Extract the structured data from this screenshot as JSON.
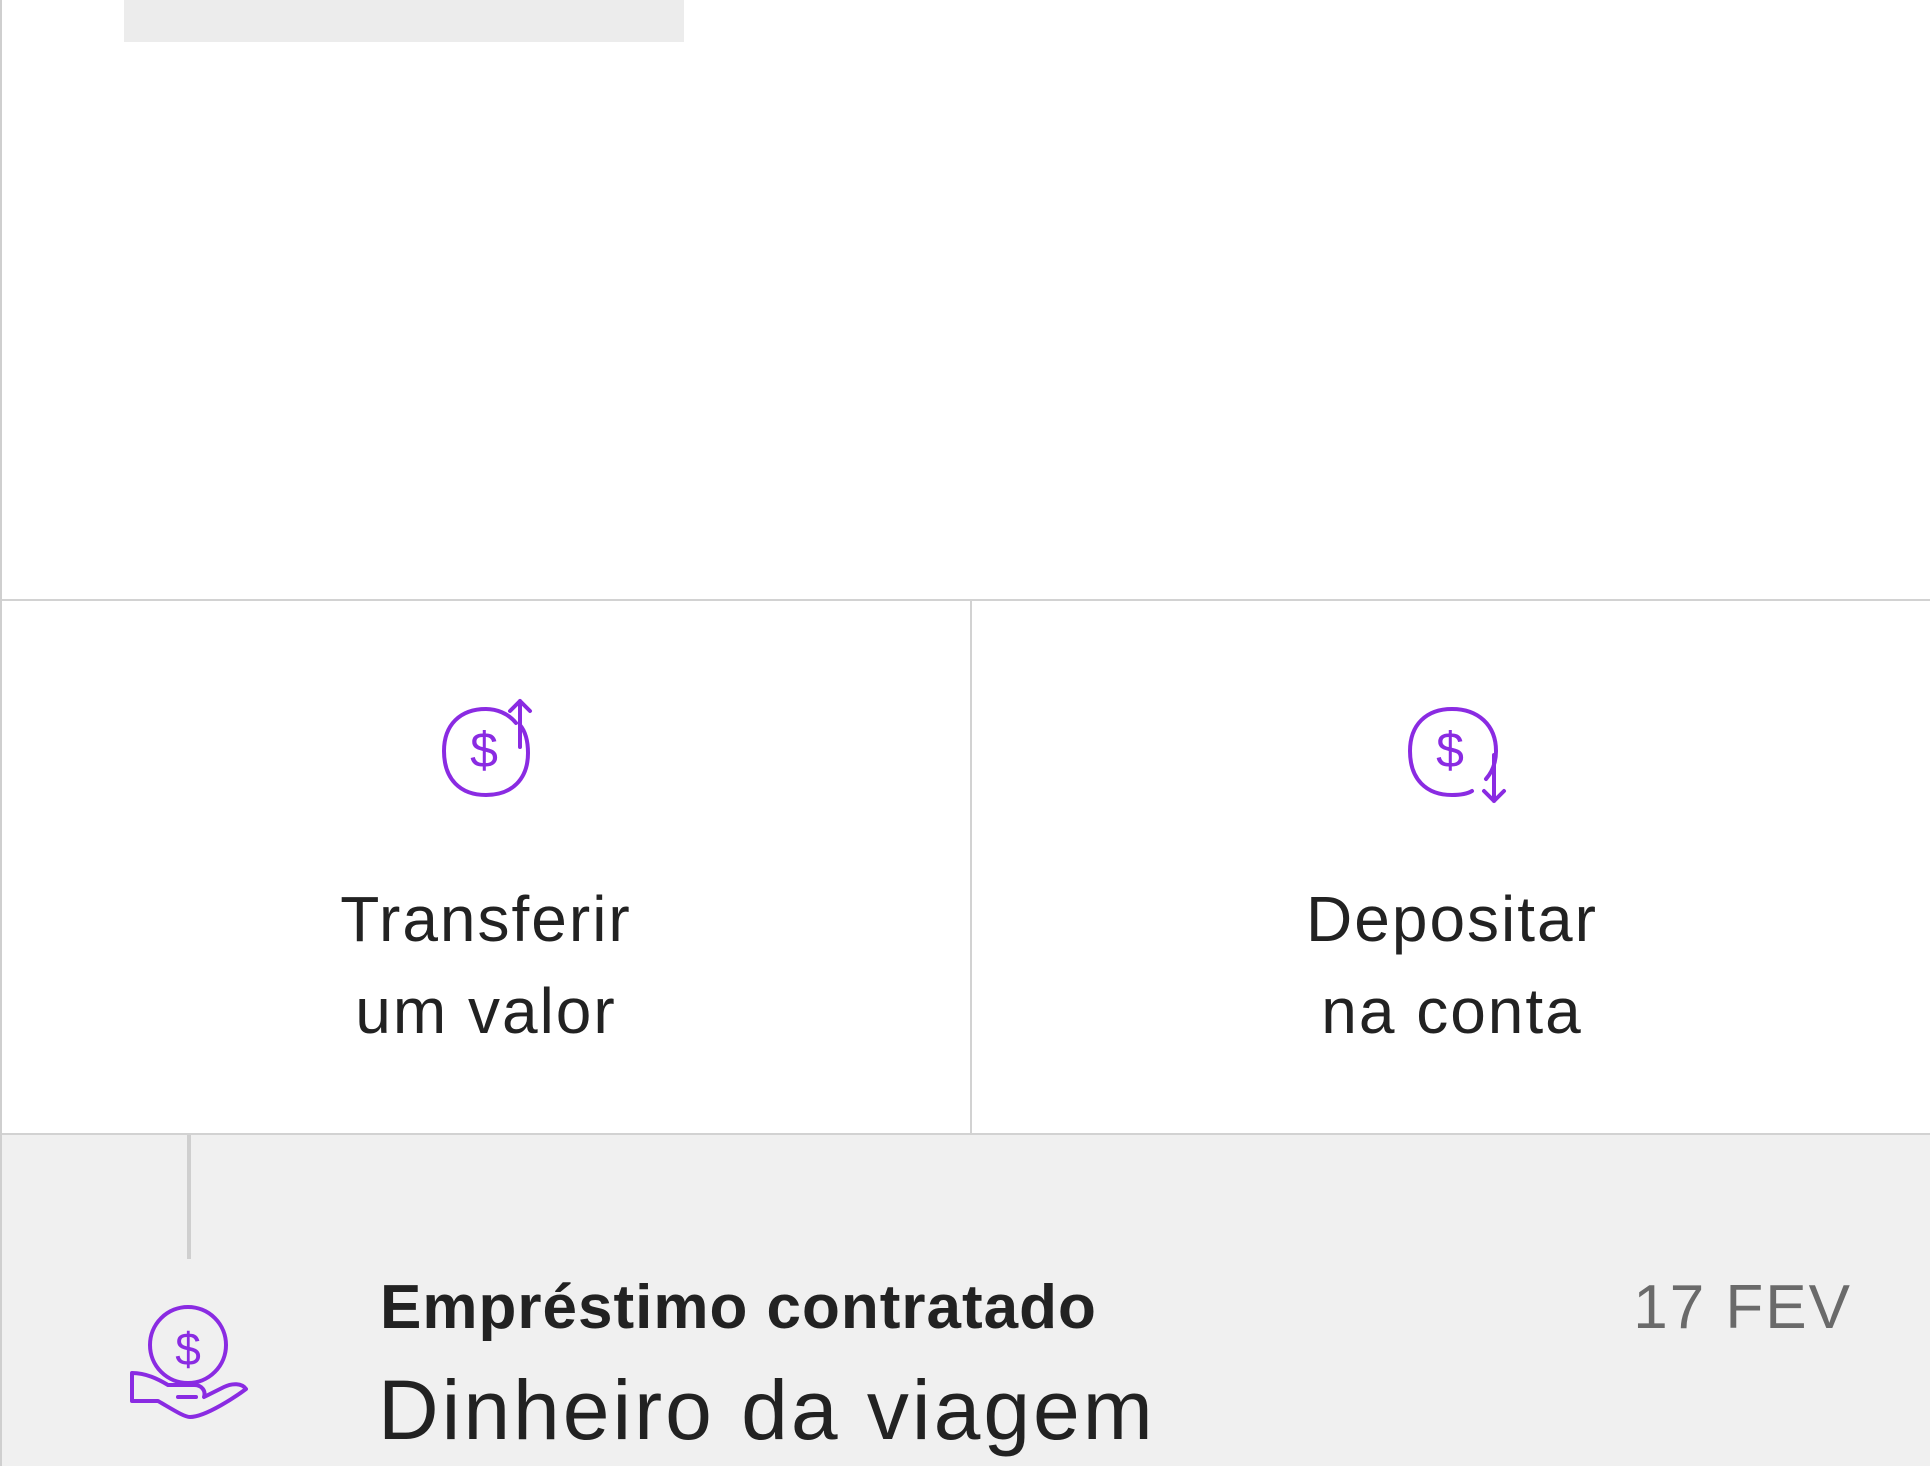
{
  "actions": [
    {
      "label_line1": "Transferir",
      "label_line2": "um valor",
      "icon": "money-transfer-up-icon"
    },
    {
      "label_line1": "Depositar",
      "label_line2": "na conta",
      "icon": "money-deposit-down-icon"
    }
  ],
  "feed": {
    "event": {
      "type": "Empréstimo contratado",
      "title": "Dinheiro da viagem",
      "date": "17 FEV",
      "icon": "loan-hand-coin-icon"
    }
  },
  "colors": {
    "accent": "#8a2be2",
    "text": "#222222",
    "muted": "#6a6a6a",
    "feed_background": "#f0f0f0"
  }
}
